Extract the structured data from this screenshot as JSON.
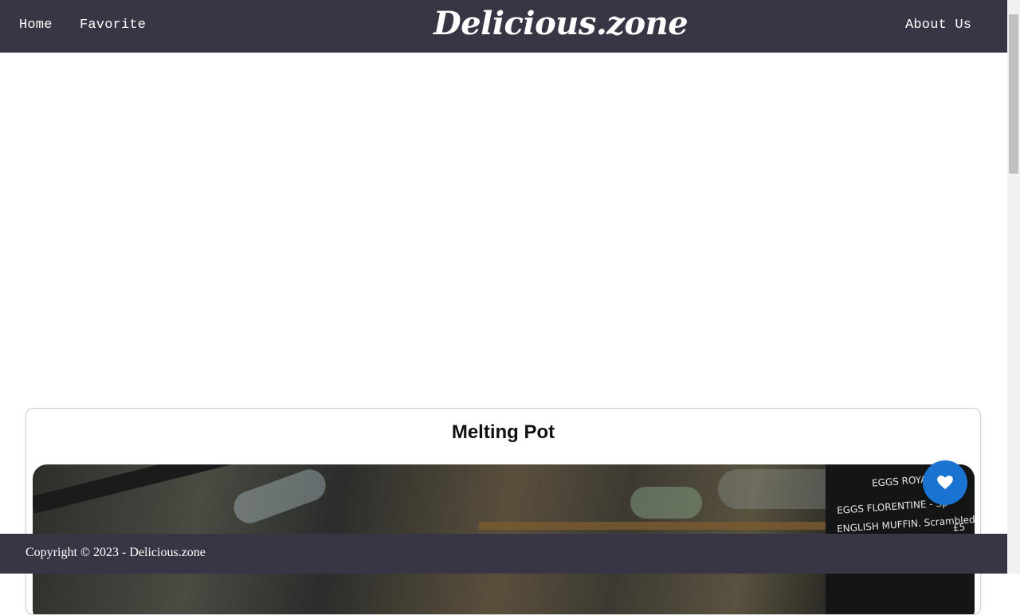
{
  "nav": {
    "home": "Home",
    "favorite": "Favorite",
    "brand": "Delicious.zone",
    "about": "About Us"
  },
  "card": {
    "title": "Melting Pot",
    "image_icon": "restaurant-photo",
    "chalkboard": [
      "EGGS ROYAL",
      "EGGS FLORENTINE - Sp",
      "ENGLISH MUFFIN. Scrambled"
    ],
    "chalk_price": "£5"
  },
  "favorite_button": {
    "icon": "heart-icon"
  },
  "footer": {
    "copyright": "Copyright © 2023 - Delicious.zone"
  },
  "colors": {
    "navbar": "#383545",
    "accent": "#1a73d1",
    "background": "#ffffff"
  }
}
